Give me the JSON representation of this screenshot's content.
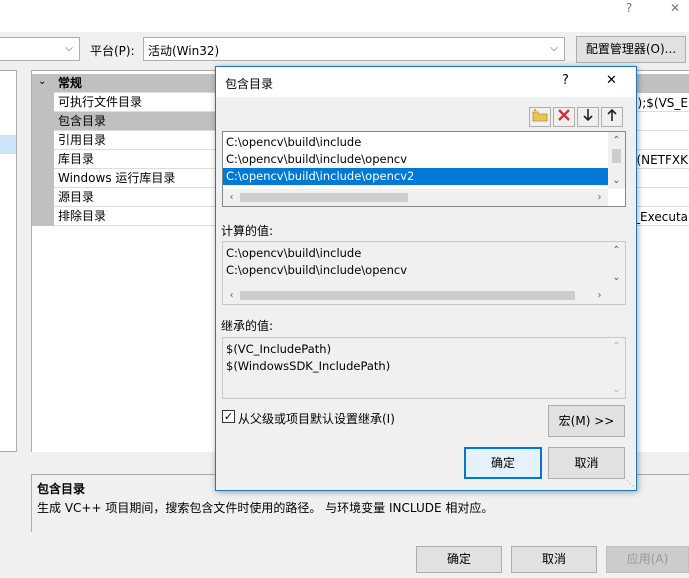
{
  "window": {
    "help": "?",
    "close": "✕"
  },
  "toolbar": {
    "config_value": "",
    "platform_label": "平台(P):",
    "platform_value": "活动(Win32)",
    "config_manager": "配置管理器(O)..."
  },
  "grid": {
    "category": "常规",
    "rows": [
      {
        "name": "可执行文件目录",
        "value": "n);$(VS_E"
      },
      {
        "name": "包含目录",
        "value": ""
      },
      {
        "name": "引用目录",
        "value": ""
      },
      {
        "name": "库目录",
        "value": "(NETFXK"
      },
      {
        "name": "Windows 运行库目录",
        "value": ""
      },
      {
        "name": "源目录",
        "value": ""
      },
      {
        "name": "排除目录",
        "value": "d_Executa"
      }
    ]
  },
  "description": {
    "title": "包含目录",
    "text": "生成 VC++ 项目期间，搜索包含文件时使用的路径。 与环境变量 INCLUDE 相对应。"
  },
  "buttons": {
    "ok": "确定",
    "cancel": "取消",
    "apply": "应用(A)"
  },
  "dialog": {
    "title": "包含目录",
    "help": "?",
    "close": "✕",
    "entries": [
      "C:\\opencv\\build\\include",
      "C:\\opencv\\build\\include\\opencv",
      "C:\\opencv\\build\\include\\opencv2"
    ],
    "selected_index": 2,
    "evaluated_label": "计算的值:",
    "evaluated": [
      "C:\\opencv\\build\\include",
      "C:\\opencv\\build\\include\\opencv"
    ],
    "inherited_label": "继承的值:",
    "inherited": [
      "$(VC_IncludePath)",
      "$(WindowsSDK_IncludePath)"
    ],
    "inherit_checkbox": "从父级或项目默认设置继承(I)",
    "inherit_checked": true,
    "macro_button": "宏(M) >>",
    "ok": "确定",
    "cancel": "取消"
  },
  "icons": {
    "new_folder": "new-folder-icon",
    "delete": "delete-icon",
    "move_down": "arrow-down-icon",
    "move_up": "arrow-up-icon"
  },
  "colors": {
    "accent": "#0078d7",
    "delete_red": "#d13438",
    "folder_yellow": "#e8c35a"
  }
}
